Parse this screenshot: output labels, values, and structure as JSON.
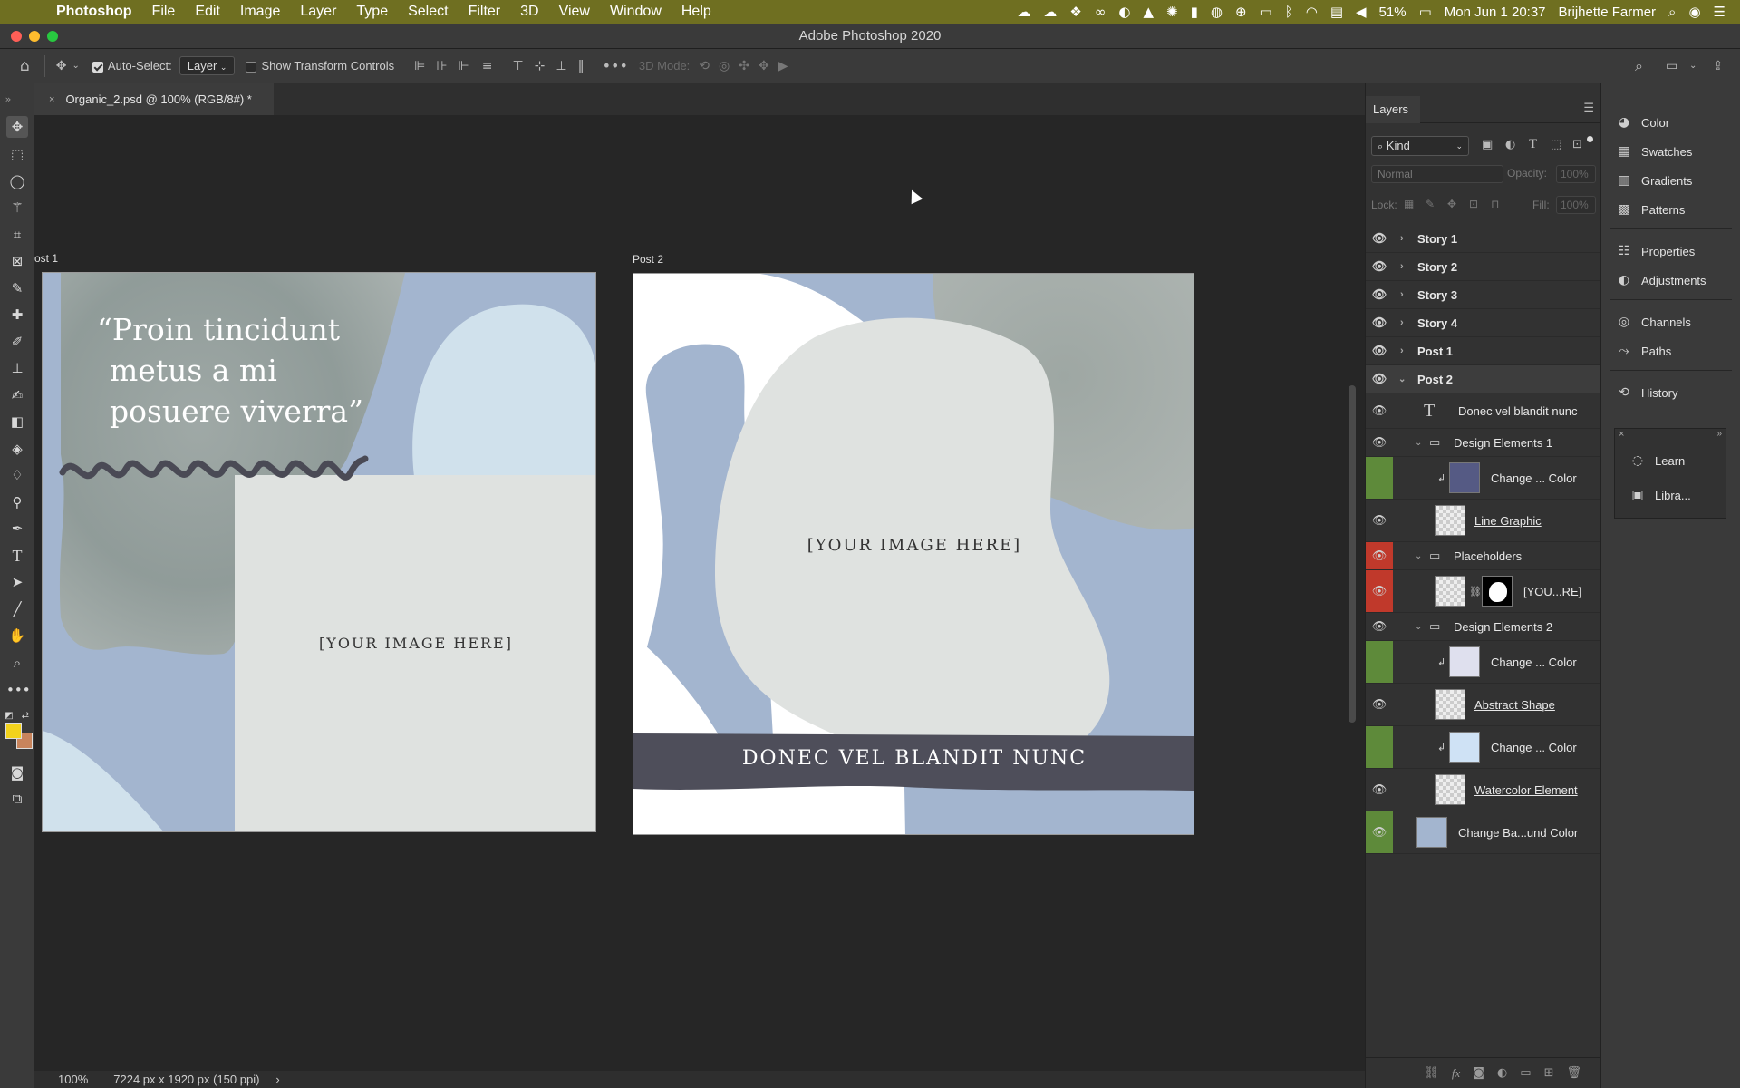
{
  "menubar": {
    "app_name": "Photoshop",
    "items": [
      "File",
      "Edit",
      "Image",
      "Layer",
      "Type",
      "Select",
      "Filter",
      "3D",
      "View",
      "Window",
      "Help"
    ],
    "battery": "51%",
    "datetime": "Mon Jun 1  20:37",
    "user": "Brijhette Farmer"
  },
  "window": {
    "title": "Adobe Photoshop 2020"
  },
  "options": {
    "auto_select_label": "Auto-Select:",
    "auto_select_value": "Layer",
    "show_transform_label": "Show Transform Controls",
    "mode_3d_label": "3D Mode:"
  },
  "document": {
    "tab_title": "Organic_2.psd @ 100% (RGB/8#) *",
    "close_glyph": "×",
    "zoom": "100%",
    "info": "7224 px x 1920 px (150 ppi)",
    "info_arrow": "›"
  },
  "artboards": [
    {
      "label": "ost 1",
      "quote_lines": [
        "“Proin tincidunt",
        "metus a mi",
        "posuere viverra”"
      ],
      "placeholder": "[YOUR IMAGE HERE]"
    },
    {
      "label": "Post 2",
      "placeholder": "[YOUR IMAGE HERE]",
      "banner": "DONEC VEL BLANDIT NUNC"
    }
  ],
  "layers_panel": {
    "tab": "Layers",
    "filter": "Kind",
    "blend_mode": "Normal",
    "opacity_label": "Opacity:",
    "opacity_value": "100%",
    "lock_label": "Lock:",
    "fill_label": "Fill:",
    "fill_value": "100%",
    "groups": [
      "Story 1",
      "Story 2",
      "Story 3",
      "Story 4",
      "Post 1",
      "Post 2"
    ],
    "rows": [
      {
        "name": "Donec vel blandit nunc"
      },
      {
        "name": "Design Elements 1"
      },
      {
        "name": "Change ... Color"
      },
      {
        "name": "Line Graphic"
      },
      {
        "name": "Placeholders"
      },
      {
        "name": "[YOU...RE]"
      },
      {
        "name": "Design Elements 2"
      },
      {
        "name": "Change ... Color"
      },
      {
        "name": "Abstract Shape"
      },
      {
        "name": "Change ... Color"
      },
      {
        "name": "Watercolor Element"
      },
      {
        "name": "Change Ba...und Color"
      }
    ]
  },
  "dock": {
    "group1": [
      "Color",
      "Swatches",
      "Gradients",
      "Patterns"
    ],
    "group2": [
      "Properties",
      "Adjustments"
    ],
    "group3": [
      "Channels",
      "Paths"
    ],
    "group4": [
      "History"
    ],
    "floating": [
      "Learn",
      "Libra..."
    ]
  },
  "colors": {
    "menubar": "#6f6f21",
    "foreground": "#f2d21c",
    "background": "#c8845c",
    "layer_green": "#5e8a3a",
    "layer_red": "#c0392b",
    "artboard_blue": "#a3b5cf",
    "light_gray": "#dfe2e0"
  }
}
